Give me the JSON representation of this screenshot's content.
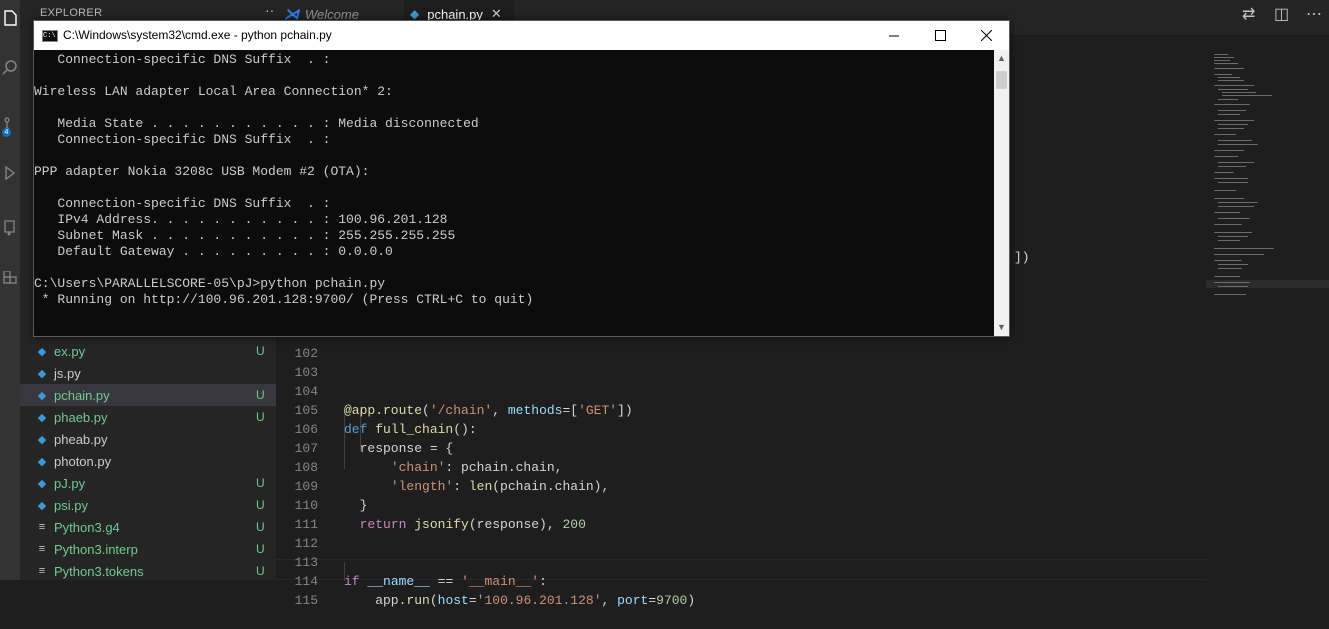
{
  "sidebar": {
    "title": "EXPLORER",
    "more": "···",
    "files": [
      {
        "name": "ex.py",
        "type": "py",
        "status": "U"
      },
      {
        "name": "js.py",
        "type": "py",
        "status": ""
      },
      {
        "name": "pchain.py",
        "type": "py",
        "status": "U"
      },
      {
        "name": "phaeb.py",
        "type": "py",
        "status": "U"
      },
      {
        "name": "pheab.py",
        "type": "py",
        "status": ""
      },
      {
        "name": "photon.py",
        "type": "py",
        "status": ""
      },
      {
        "name": "pJ.py",
        "type": "py",
        "status": "U"
      },
      {
        "name": "psi.py",
        "type": "py",
        "status": "U"
      },
      {
        "name": "Python3.g4",
        "type": "txt",
        "status": "U"
      },
      {
        "name": "Python3.interp",
        "type": "txt",
        "status": "U"
      },
      {
        "name": "Python3.tokens",
        "type": "txt",
        "status": "U"
      }
    ]
  },
  "tabs": [
    {
      "label": "Welcome"
    },
    {
      "label": "pchain.py"
    }
  ],
  "editor": {
    "line_numbers": [
      "102",
      "103",
      "104",
      "105",
      "106",
      "107",
      "108",
      "109",
      "110",
      "111",
      "112",
      "113",
      "114",
      "115"
    ],
    "stray_text": "])"
  },
  "cmd": {
    "title": "C:\\Windows\\system32\\cmd.exe - python  pchain.py",
    "lines": [
      "   Connection-specific DNS Suffix  . :",
      "",
      "Wireless LAN adapter Local Area Connection* 2:",
      "",
      "   Media State . . . . . . . . . . . : Media disconnected",
      "   Connection-specific DNS Suffix  . :",
      "",
      "PPP adapter Nokia 3208c USB Modem #2 (OTA):",
      "",
      "   Connection-specific DNS Suffix  . :",
      "   IPv4 Address. . . . . . . . . . . : 100.96.201.128",
      "   Subnet Mask . . . . . . . . . . . : 255.255.255.255",
      "   Default Gateway . . . . . . . . . : 0.0.0.0",
      "",
      "C:\\Users\\PARALLELSCORE-05\\pJ>python pchain.py",
      " * Running on http://100.96.201.128:9700/ (Press CTRL+C to quit)"
    ]
  },
  "colors": {
    "activity_bar": "#333333",
    "sidebar_bg": "#252526",
    "editor_bg": "#1e1e1e",
    "untracked": "#73c991",
    "python_icon": "#3c9bd6",
    "cmd_bg": "#0c0c0c"
  }
}
